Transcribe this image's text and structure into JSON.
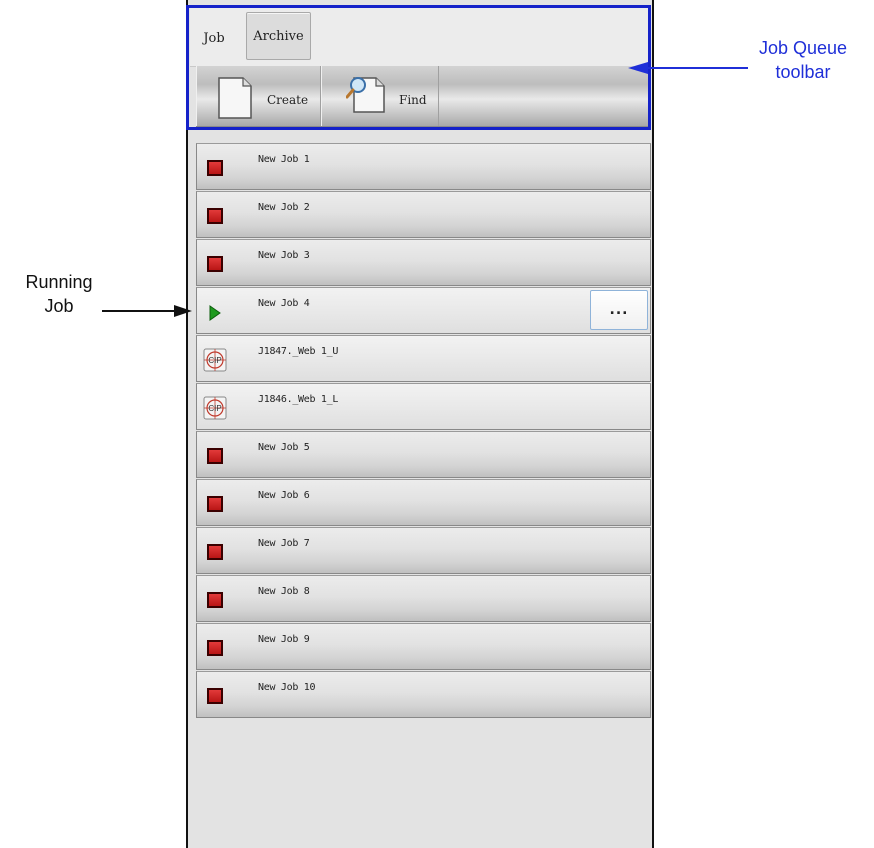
{
  "tabs": [
    {
      "label": "Job",
      "active": true
    },
    {
      "label": "Archive",
      "active": false
    }
  ],
  "toolbar": {
    "create_label": "Create",
    "find_label": "Find",
    "create_icon": "document-icon",
    "find_icon": "document-search-icon"
  },
  "jobs": [
    {
      "name": "New Job 1",
      "status": "stopped"
    },
    {
      "name": "New Job 2",
      "status": "stopped"
    },
    {
      "name": "New Job 3",
      "status": "stopped"
    },
    {
      "name": "New Job 4",
      "status": "running",
      "more_label": "..."
    },
    {
      "name": "J1847._Web 1_U",
      "status": "cip"
    },
    {
      "name": "J1846._Web 1_L",
      "status": "cip"
    },
    {
      "name": "New Job 5",
      "status": "stopped"
    },
    {
      "name": "New Job 6",
      "status": "stopped"
    },
    {
      "name": "New Job 7",
      "status": "stopped"
    },
    {
      "name": "New Job 8",
      "status": "stopped"
    },
    {
      "name": "New Job 9",
      "status": "stopped"
    },
    {
      "name": "New Job 10",
      "status": "stopped"
    }
  ],
  "annotations": {
    "toolbar_callout": [
      "Job Queue",
      "toolbar"
    ],
    "running_callout": [
      "Running",
      "Job"
    ]
  },
  "colors": {
    "annotation_blue": "#1f2fd8",
    "stopped_red": "#c21a1a",
    "running_green": "#1f9a1f"
  }
}
